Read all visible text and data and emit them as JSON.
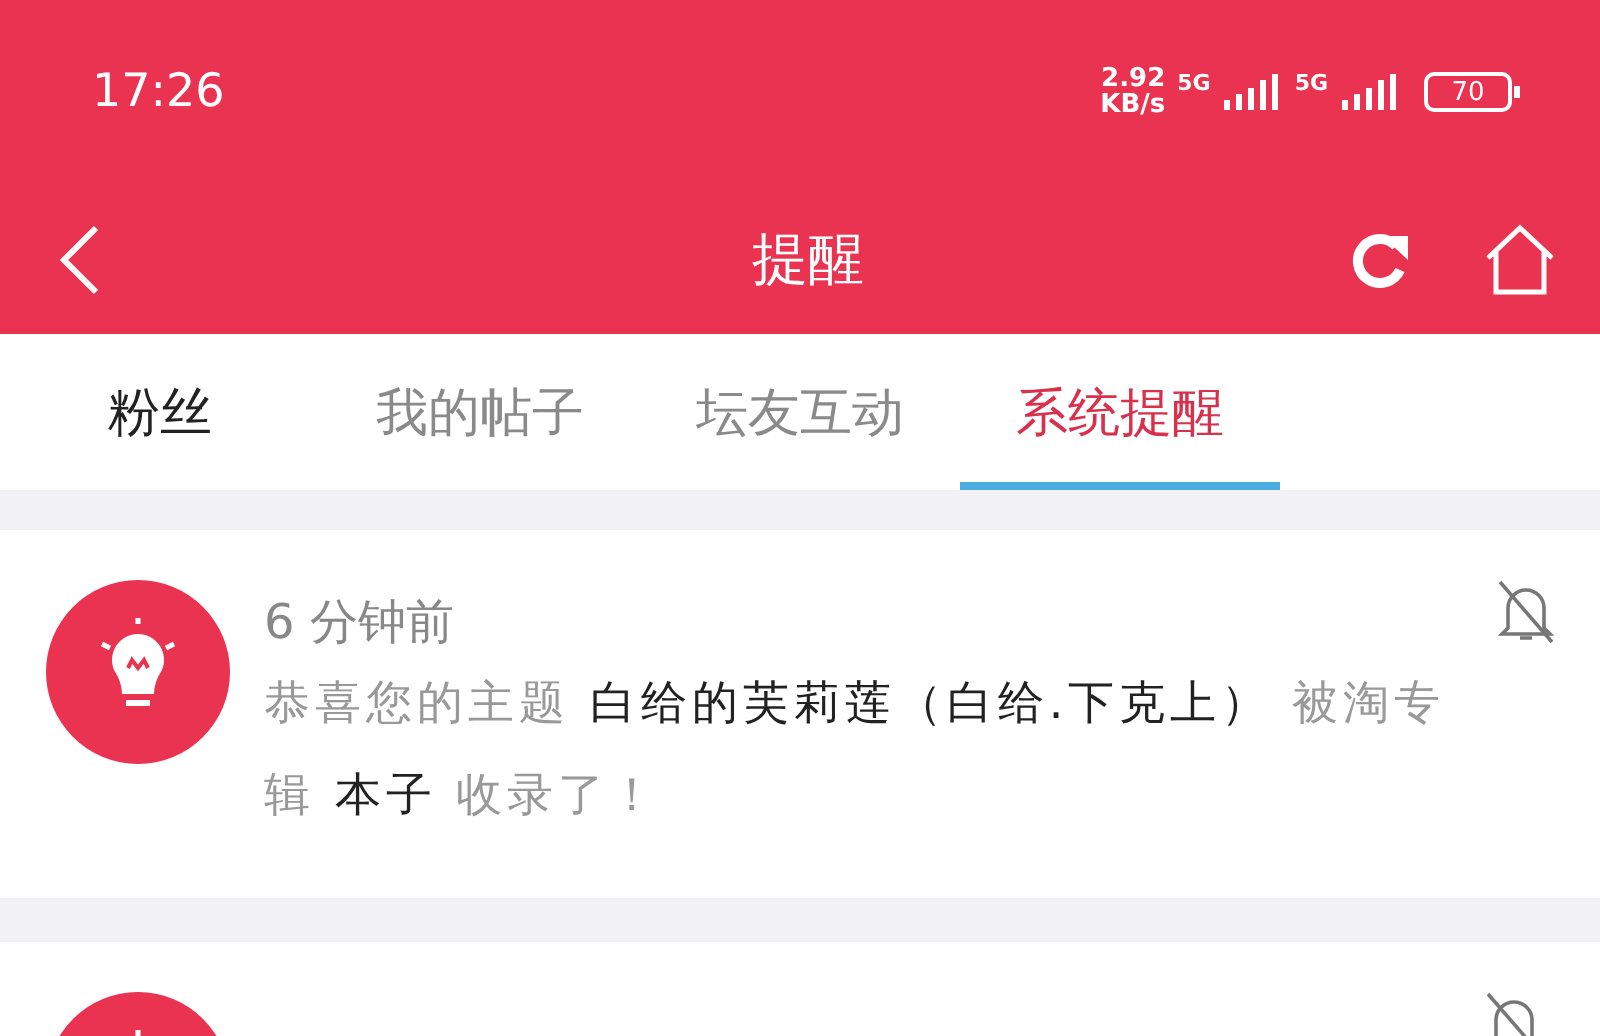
{
  "status_bar": {
    "time": "17:26",
    "speed": "2.92",
    "speed_unit": "KB/s",
    "network_1": "5G",
    "network_2": "5G",
    "battery": "70"
  },
  "header": {
    "title": "提醒"
  },
  "tabs": [
    {
      "label": "粉丝",
      "selected": false,
      "emphasized": true
    },
    {
      "label": "我的帖子",
      "selected": false,
      "emphasized": false
    },
    {
      "label": "坛友互动",
      "selected": false,
      "emphasized": false
    },
    {
      "label": "系统提醒",
      "selected": true,
      "emphasized": false
    }
  ],
  "notifications": [
    {
      "time": "6 分钟前",
      "muted": true,
      "message": "恭喜您的主题 **白给的芙莉莲（白给.下克上）** 被淘专辑 **本子** 收录了！"
    },
    {
      "muted": true
    }
  ]
}
